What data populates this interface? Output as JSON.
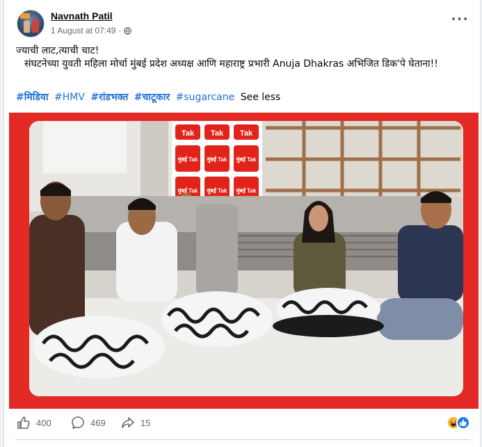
{
  "post": {
    "author": "Navnath Patil",
    "timestamp": "1 August at 07:49",
    "separator": "·",
    "privacy_icon": "globe-icon",
    "more_icon": "more-horizontal-icon",
    "text_line1": "ज्याची लाट,त्याची चाट!",
    "text_line2": "संघटनेच्या युवती महिला मोर्चा मुंबई प्रदेश अध्यक्ष आणि महाराष्ट्र प्रभारी Anuja Dhakras अभिजित डिक'पे घेताना!!",
    "hashtags": [
      "#मिडिया",
      "#HMV",
      "#रांडभक्त",
      "#चाटूकार",
      "#sugarcane"
    ],
    "see_less": "See less"
  },
  "media": {
    "backdrop_color": "#e42a24",
    "banner_tiles": [
      "Tak",
      "मुंबई Tak"
    ]
  },
  "actions": {
    "like_count": "400",
    "comment_count": "469",
    "share_count": "15",
    "like_icon": "thumbs-up-icon",
    "comment_icon": "comment-icon",
    "share_icon": "share-icon",
    "reactions": [
      "haha",
      "like"
    ]
  },
  "colors": {
    "link": "#216fdb",
    "muted": "#65676b",
    "like_blue": "#1877f2",
    "haha_yellow": "#f7b125"
  }
}
